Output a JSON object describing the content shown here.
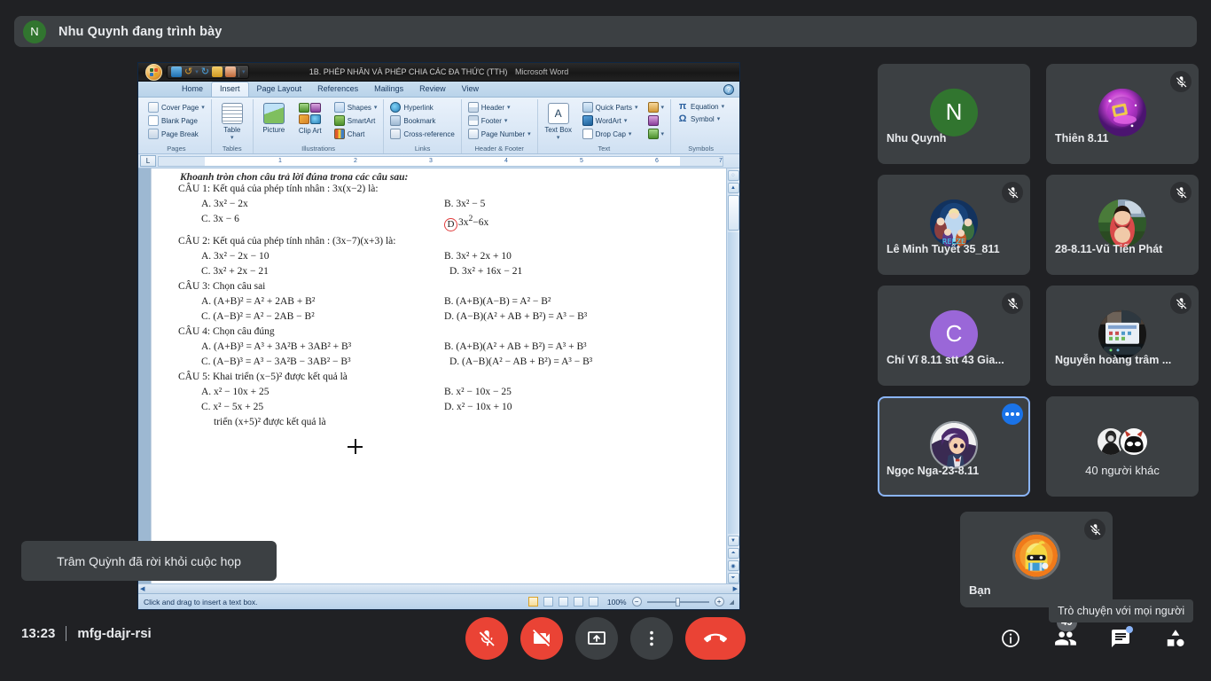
{
  "presenter": {
    "avatar_letter": "N",
    "avatar_color": "#31752f",
    "text": "Nhu Quynh đang trình bày"
  },
  "toast": {
    "text": "Trâm Quỳnh đã rời khỏi cuộc họp"
  },
  "tooltip": {
    "text": "Trò chuyện với mọi người"
  },
  "shared_screen": {
    "app": "Microsoft Word",
    "title": "1B. PHÉP NHÂN VÀ PHÉP CHIA CÁC ĐA THỨC (TTH)",
    "app_suffix": "Microsoft Word",
    "quick_access": [
      "save-icon",
      "undo-icon",
      "redo-icon",
      "open-icon",
      "print-preview-icon",
      "customize-icon"
    ],
    "tabs": [
      {
        "label": "Home",
        "active": false
      },
      {
        "label": "Insert",
        "active": true
      },
      {
        "label": "Page Layout",
        "active": false
      },
      {
        "label": "References",
        "active": false
      },
      {
        "label": "Mailings",
        "active": false
      },
      {
        "label": "Review",
        "active": false
      },
      {
        "label": "View",
        "active": false
      }
    ],
    "ribbon_groups": [
      {
        "name": "Pages",
        "items": [
          "Cover Page",
          "Blank Page",
          "Page Break"
        ]
      },
      {
        "name": "Tables",
        "items": [
          "Table"
        ]
      },
      {
        "name": "Illustrations",
        "items": [
          "Picture",
          "Clip Art",
          "Shapes",
          "SmartArt",
          "Chart"
        ]
      },
      {
        "name": "Links",
        "items": [
          "Hyperlink",
          "Bookmark",
          "Cross-reference"
        ]
      },
      {
        "name": "Header & Footer",
        "items": [
          "Header",
          "Footer",
          "Page Number"
        ]
      },
      {
        "name": "Text",
        "items": [
          "Text Box",
          "Quick Parts",
          "WordArt",
          "Drop Cap",
          "Signature Line",
          "Date & Time",
          "Object"
        ]
      },
      {
        "name": "Symbols",
        "items": [
          "Equation",
          "Symbol"
        ]
      }
    ],
    "ruler": {
      "corner_label": "L",
      "numbers": [
        "1",
        "2",
        "3",
        "4",
        "5",
        "6",
        "7"
      ]
    },
    "document": {
      "clipped_top_line": "Khoanh tròn  chọn câu trả lời đúng trong các câu sau:",
      "questions": [
        {
          "head": "CÂU 1: Kết quả của phép tính nhân :  3x(x−2) là:",
          "a": "A.  3x² − 2x",
          "b": "B. 3x² − 5",
          "c": "C. 3x − 6",
          "d": "D.) 3x² − 6x",
          "d_circled": true
        },
        {
          "head": "CÂU 2: Kết quả của phép tính nhân :  (3x−7)(x+3) là:",
          "a": "A. 3x² − 2x − 10",
          "b": "B. 3x² + 2x + 10",
          "c": "C. 3x² + 2x − 21",
          "d": "D. 3x² + 16x − 21",
          "d_circled": false
        },
        {
          "head": "CÂU 3:  Chọn câu sai",
          "a": "A. (A+B)² = A² + 2AB + B²",
          "b": "B. (A+B)(A−B) = A² − B²",
          "c": "C. (A−B)² = A² − 2AB − B²",
          "d": "D. (A−B)(A² + AB + B²) = A³ − B³",
          "d_circled": false
        },
        {
          "head": "CÂU 4: Chọn câu đúng",
          "a": "A. (A+B)³ = A³ + 3A²B + 3AB² + B³",
          "b": "B. (A+B)(A² + AB + B²) = A³ + B³",
          "c": "C. (A−B)³ = A³ − 3A²B − 3AB² − B³",
          "d": "D. (A−B)(A² − AB + B²) = A³ − B³",
          "d_circled": false
        },
        {
          "head": "CÂU 5: Khai triển  (x−5)² được kết quả là",
          "a": "A. x² − 10x + 25",
          "b": "B.  x² − 10x − 25",
          "c": "C. x² − 5x + 25",
          "d": "D.  x² − 10x + 10",
          "d_circled": false
        }
      ],
      "last_partial_line": "triển  (x+5)² được kết quả là"
    },
    "status_bar": {
      "hint": "Click and drag to insert a text box.",
      "zoom": "100%"
    }
  },
  "participants": [
    {
      "name": "Nhu Quynh",
      "type": "letter",
      "letter": "N",
      "color": "#31752f",
      "muted": false,
      "selected": false
    },
    {
      "name": "Thiên 8.11",
      "type": "art-magic",
      "muted": true,
      "selected": false
    },
    {
      "name": "Lê Minh Tuyết 35_811",
      "type": "art-frozen",
      "muted": true,
      "selected": false
    },
    {
      "name": "28-8.11-Vũ Tiến Phát",
      "type": "art-red",
      "muted": true,
      "selected": false
    },
    {
      "name": "Chí Vĩ 8.11 stt 43 Gia...",
      "type": "letter",
      "letter": "C",
      "color": "#9a67d8",
      "muted": true,
      "selected": false
    },
    {
      "name": "Nguyễn hoàng trâm ...",
      "type": "art-desk",
      "muted": true,
      "selected": false
    },
    {
      "name": "Ngọc Nga-23-8.11",
      "type": "art-anime",
      "muted": false,
      "selected": true,
      "more_menu": true
    },
    {
      "name": "40 người khác",
      "type": "others",
      "muted": false,
      "selected": false
    }
  ],
  "self_tile": {
    "name": "Bạn",
    "muted": true
  },
  "bottom_bar": {
    "time": "13:23",
    "meeting_code": "mfg-dajr-rsi",
    "controls": [
      {
        "name": "microphone-off-button",
        "icon": "mic-off-icon",
        "state": "muted"
      },
      {
        "name": "camera-off-button",
        "icon": "video-off-icon",
        "state": "off"
      },
      {
        "name": "present-screen-button",
        "icon": "present-icon",
        "state": "default"
      },
      {
        "name": "more-options-button",
        "icon": "more-vert-icon",
        "state": "default"
      },
      {
        "name": "leave-call-button",
        "icon": "hangup-icon",
        "state": "default"
      }
    ],
    "right_controls": [
      {
        "name": "meeting-details-button",
        "icon": "info-icon",
        "badge": null
      },
      {
        "name": "show-everyone-button",
        "icon": "people-icon",
        "badge": "49"
      },
      {
        "name": "chat-button",
        "icon": "chat-icon",
        "badge": null,
        "dot": true
      },
      {
        "name": "activities-button",
        "icon": "activities-icon",
        "badge": null
      }
    ]
  }
}
